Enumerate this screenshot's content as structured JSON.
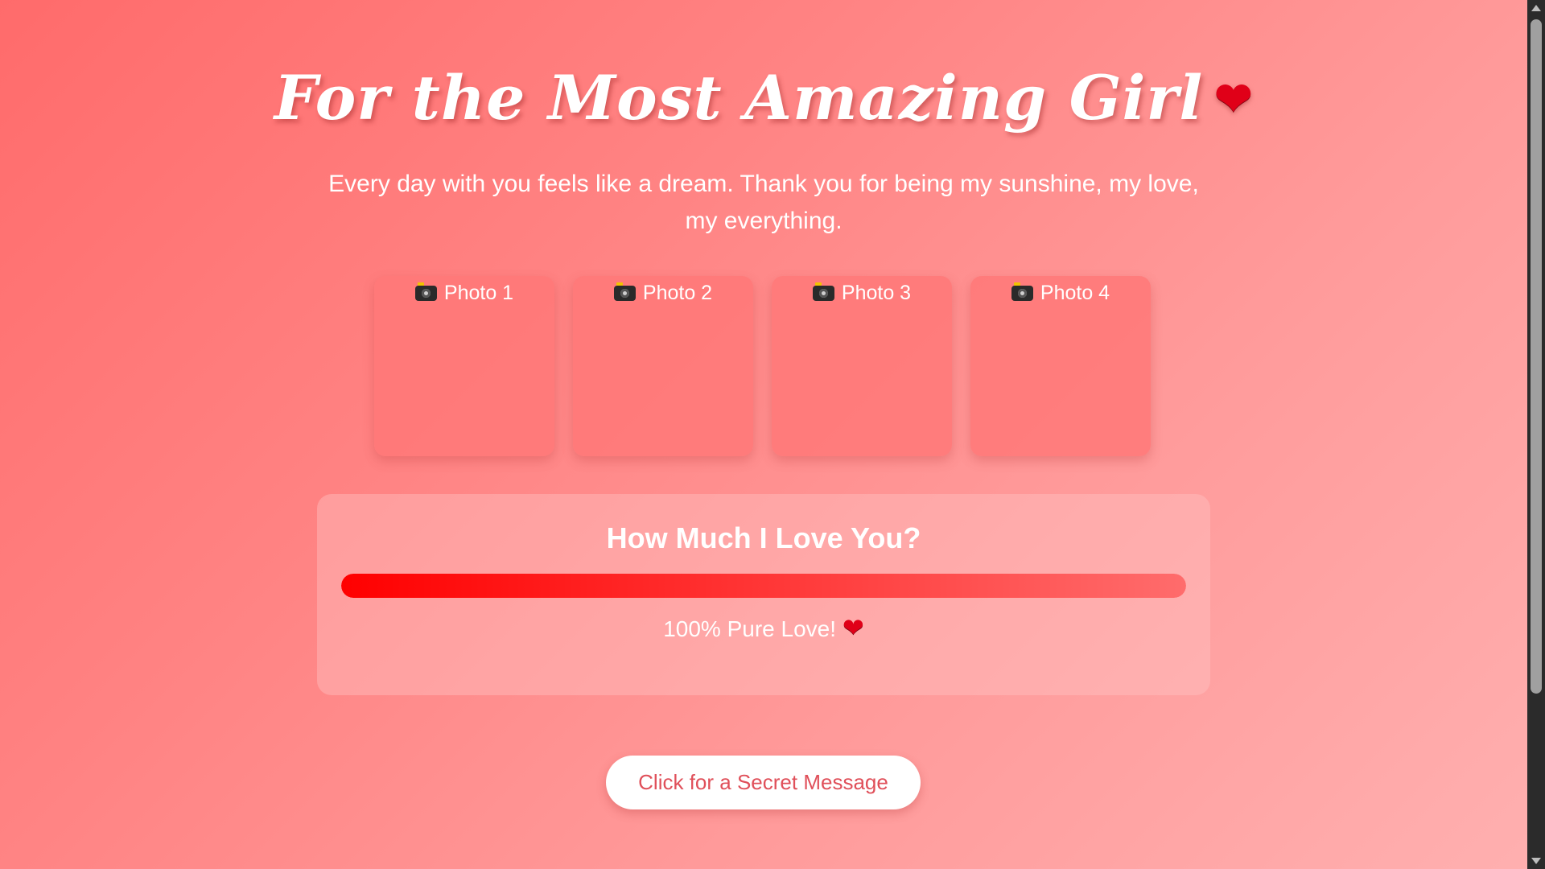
{
  "header": {
    "title": "For the Most Amazing Girl",
    "title_icon": "heart-icon",
    "subtitle": "Every day with you feels like a dream. Thank you for being my sunshine, my love, my everything."
  },
  "photos": [
    {
      "icon": "camera-icon",
      "label": "Photo 1"
    },
    {
      "icon": "camera-icon",
      "label": "Photo 2"
    },
    {
      "icon": "camera-icon",
      "label": "Photo 3"
    },
    {
      "icon": "camera-icon",
      "label": "Photo 4"
    }
  ],
  "love_meter": {
    "title": "How Much I Love You?",
    "progress": 1.0,
    "caption": "100% Pure Love!",
    "caption_icon": "heart-icon",
    "fill_colors": [
      "#ff0000",
      "#ff6c6c"
    ]
  },
  "secret_button": {
    "label": "Click for a Secret Message"
  },
  "bottom": {
    "partial_text": ""
  },
  "colors": {
    "background_start": "#ff6b6b",
    "background_end": "#ffb0b0",
    "heart": "#e00018",
    "button_text": "#e0505a"
  }
}
